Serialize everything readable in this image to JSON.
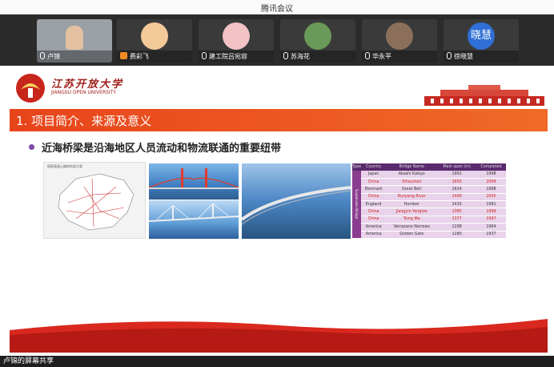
{
  "window": {
    "title": "腾讯会议"
  },
  "participants": [
    {
      "name": "卢锦",
      "type": "video",
      "mic": true
    },
    {
      "name": "费彩飞",
      "type": "avatar",
      "avatar_color": "#f4c99a"
    },
    {
      "name": "建工院吕宛容",
      "type": "avatar",
      "avatar_color": "#f2c2c6"
    },
    {
      "name": "苏海花",
      "type": "avatar",
      "avatar_color": "#6a9a5a"
    },
    {
      "name": "华永平",
      "type": "avatar",
      "avatar_color": "#8b6f5a"
    },
    {
      "name": "徐晓慧",
      "type": "avatar",
      "avatar_color": "#2f6fd6",
      "avatar_text": "晓慧"
    }
  ],
  "slide": {
    "logo_cn": "江苏开放大学",
    "logo_en": "JIANGSU OPEN UNIVERSITY",
    "section_title": "1. 项目简介、来源及意义",
    "bullet": "近海桥梁是沿海地区人员流动和物流联通的重要纽带",
    "map_caption": "国家高速公路网布局方案",
    "table": {
      "headers": [
        "Type",
        "Country",
        "Bridge Name",
        "Main span (m)",
        "Completed"
      ],
      "side_label": "Suspension Bridge",
      "rows": [
        {
          "country": "Japan",
          "name": "Akashi Kaikyo",
          "span": "1991",
          "year": "1998",
          "cn": false
        },
        {
          "country": "China",
          "name": "Xihoumen",
          "span": "1650",
          "year": "2009",
          "cn": true
        },
        {
          "country": "Denmark",
          "name": "Great Belt",
          "span": "1624",
          "year": "1998",
          "cn": false
        },
        {
          "country": "China",
          "name": "Runyang River",
          "span": "1490",
          "year": "2005",
          "cn": true
        },
        {
          "country": "England",
          "name": "Humber",
          "span": "1410",
          "year": "1981",
          "cn": false
        },
        {
          "country": "China",
          "name": "Jiangyin Yangtze",
          "span": "1385",
          "year": "1999",
          "cn": true
        },
        {
          "country": "China",
          "name": "Tsing Ma",
          "span": "1377",
          "year": "1997",
          "cn": true
        },
        {
          "country": "America",
          "name": "Verrazano Narrows",
          "span": "1298",
          "year": "1964",
          "cn": false
        },
        {
          "country": "America",
          "name": "Golden Gate",
          "span": "1280",
          "year": "1937",
          "cn": false
        }
      ]
    }
  },
  "share_bar": {
    "label": "卢锦的屏幕共享"
  },
  "colors": {
    "accent": "#e8441b",
    "brand_red": "#a0201a"
  }
}
